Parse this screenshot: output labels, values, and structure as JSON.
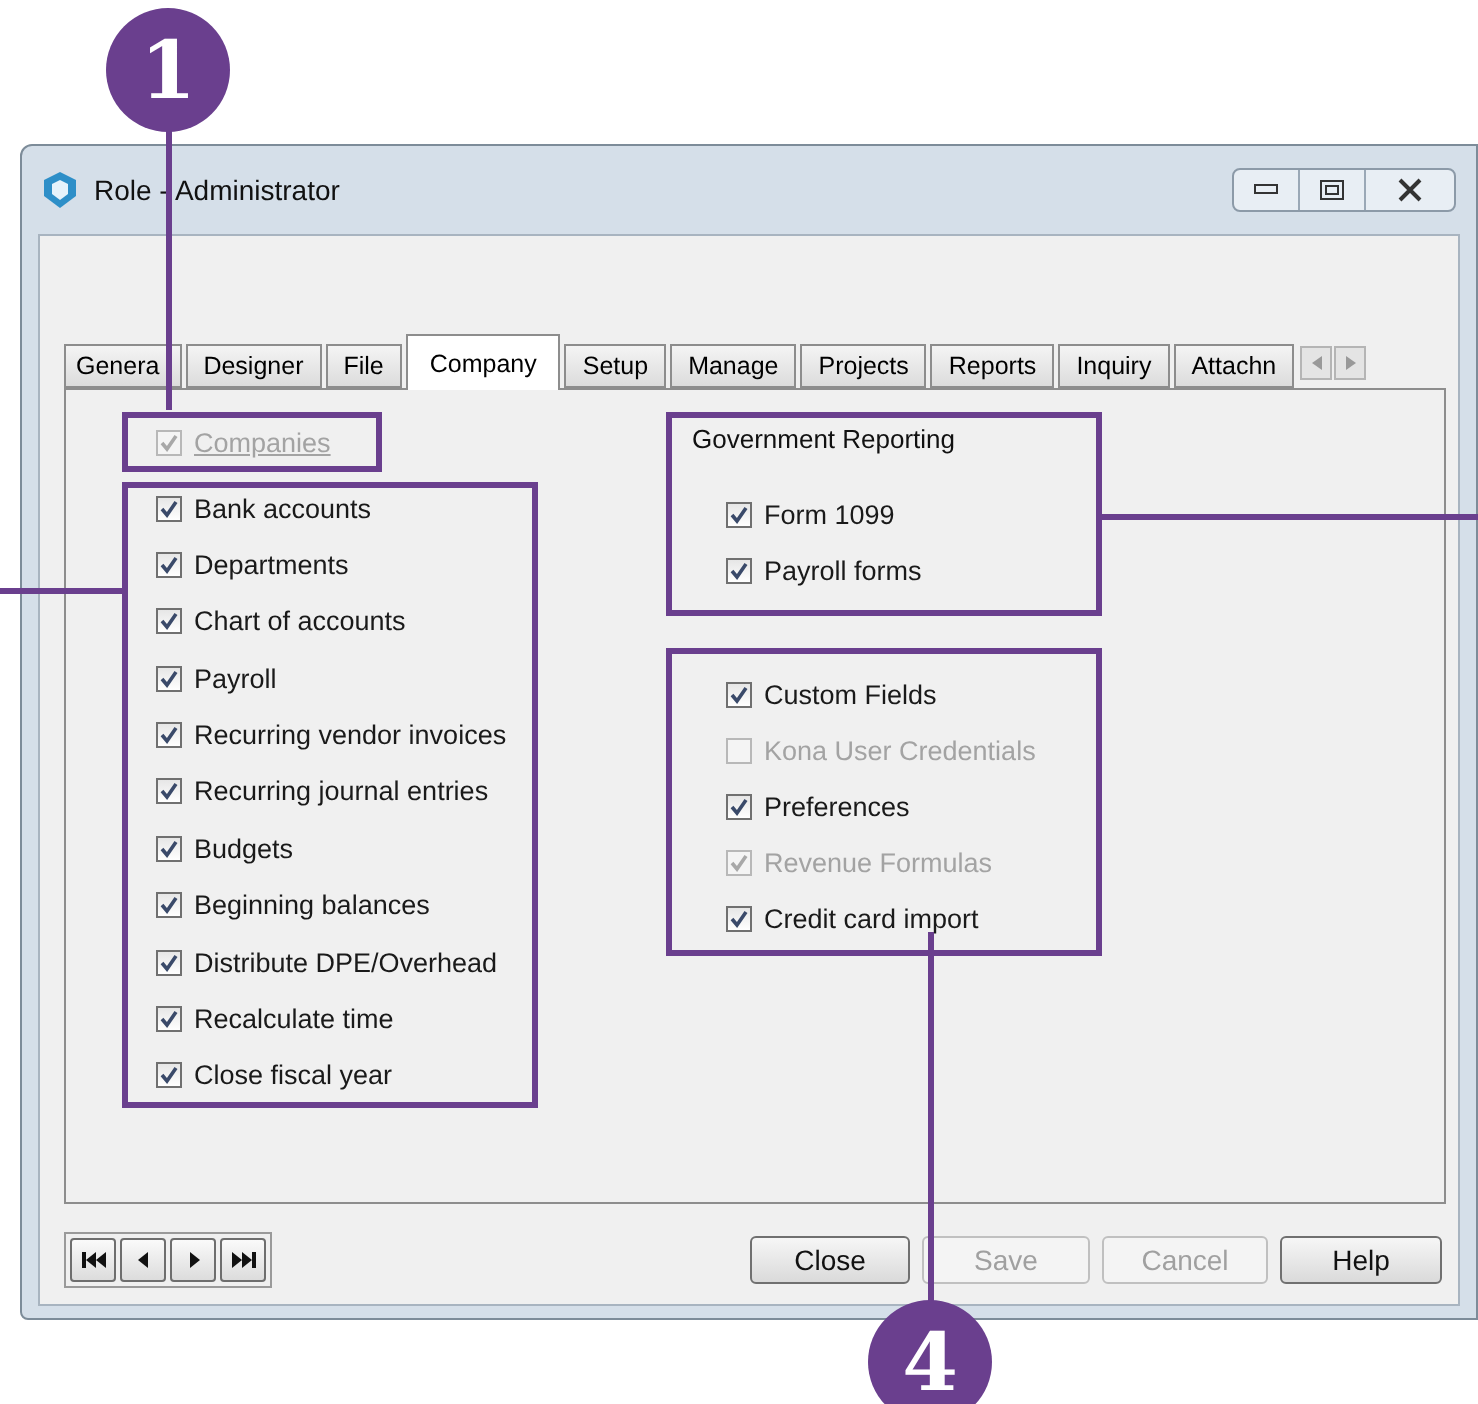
{
  "window": {
    "title": "Role - Administrator"
  },
  "tabs": [
    {
      "label": "Genera",
      "selected": false
    },
    {
      "label": "Designer",
      "selected": false
    },
    {
      "label": "File",
      "selected": false
    },
    {
      "label": "Company",
      "selected": true
    },
    {
      "label": "Setup",
      "selected": false
    },
    {
      "label": "Manage",
      "selected": false
    },
    {
      "label": "Projects",
      "selected": false
    },
    {
      "label": "Reports",
      "selected": false
    },
    {
      "label": "Inquiry",
      "selected": false
    },
    {
      "label": "Attachn",
      "selected": false
    }
  ],
  "companies": {
    "label": "Companies",
    "checked": true,
    "disabled": true
  },
  "permissions": [
    {
      "label": "Bank accounts",
      "checked": true,
      "disabled": false
    },
    {
      "label": "Departments",
      "checked": true,
      "disabled": false
    },
    {
      "label": "Chart of accounts",
      "checked": true,
      "disabled": false
    },
    {
      "label": "Payroll",
      "checked": true,
      "disabled": false
    },
    {
      "label": "Recurring vendor invoices",
      "checked": true,
      "disabled": false
    },
    {
      "label": "Recurring journal entries",
      "checked": true,
      "disabled": false
    },
    {
      "label": "Budgets",
      "checked": true,
      "disabled": false
    },
    {
      "label": "Beginning balances",
      "checked": true,
      "disabled": false
    },
    {
      "label": "Distribute DPE/Overhead",
      "checked": true,
      "disabled": false
    },
    {
      "label": "Recalculate time",
      "checked": true,
      "disabled": false
    },
    {
      "label": "Close fiscal year",
      "checked": true,
      "disabled": false
    }
  ],
  "government_reporting": {
    "title": "Government Reporting",
    "items": [
      {
        "label": "Form 1099",
        "checked": true,
        "disabled": false
      },
      {
        "label": "Payroll forms",
        "checked": true,
        "disabled": false
      }
    ]
  },
  "other_permissions": [
    {
      "label": "Custom Fields",
      "checked": true,
      "disabled": false
    },
    {
      "label": "Kona User Credentials",
      "checked": false,
      "disabled": true
    },
    {
      "label": "Preferences",
      "checked": true,
      "disabled": false
    },
    {
      "label": "Revenue Formulas",
      "checked": true,
      "disabled": true
    },
    {
      "label": "Credit card import",
      "checked": true,
      "disabled": false
    }
  ],
  "buttons": [
    {
      "label": "Close",
      "disabled": false
    },
    {
      "label": "Save",
      "disabled": true
    },
    {
      "label": "Cancel",
      "disabled": true
    },
    {
      "label": "Help",
      "disabled": false
    }
  ],
  "callouts": [
    {
      "number": "1"
    },
    {
      "number": "4"
    }
  ]
}
